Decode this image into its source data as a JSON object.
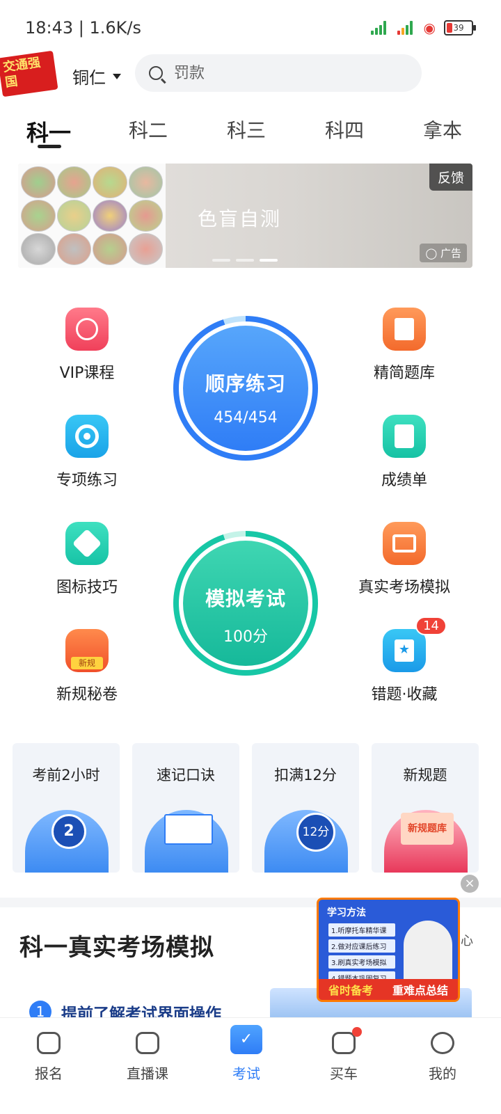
{
  "status": {
    "time": "18:43 | 1.6K/s",
    "battery": "39"
  },
  "header": {
    "logo_text": "交通强国",
    "city": "铜仁",
    "search_placeholder": "罚款"
  },
  "tabs": [
    {
      "label": "科一"
    },
    {
      "label": "科二"
    },
    {
      "label": "科三"
    },
    {
      "label": "科四"
    },
    {
      "label": "拿本"
    }
  ],
  "banner": {
    "title": "色盲自测",
    "feedback": "反馈",
    "ad_tag": "广告"
  },
  "features": {
    "vip": "VIP课程",
    "special": "专项练习",
    "icons_tips": "图标技巧",
    "new_rules_secret": "新规秘卷",
    "new_rules_badge": "新规",
    "slim_bank": "精简题库",
    "report": "成绩单",
    "real_exam_sim": "真实考场模拟",
    "mistakes": "错题·收藏",
    "mistakes_count": "14"
  },
  "practice": {
    "sequence_title": "顺序练习",
    "sequence_progress": "454/454",
    "mock_title": "模拟考试",
    "mock_score": "100分"
  },
  "cards": [
    {
      "title": "考前2小时",
      "art_text": "2"
    },
    {
      "title": "速记口诀"
    },
    {
      "title": "扣满12分",
      "art_text": "12分"
    },
    {
      "title": "新规题",
      "art_text": "新规题库"
    }
  ],
  "section": {
    "title": "科一真实考场模拟",
    "step_num": "1",
    "step_text": "提前了解考试界面操作",
    "side_text": "心"
  },
  "float_ad": {
    "title": "学习方法",
    "items": [
      "1.听摩托车精华课",
      "2.做对应课后练习",
      "3.刷真实考场模拟",
      "4.错题本巩固复习"
    ],
    "bar_left": "省时备考",
    "bar_right": "重难点总结"
  },
  "bottom_nav": [
    {
      "label": "报名"
    },
    {
      "label": "直播课"
    },
    {
      "label": "考试"
    },
    {
      "label": "买车"
    },
    {
      "label": "我的"
    }
  ]
}
